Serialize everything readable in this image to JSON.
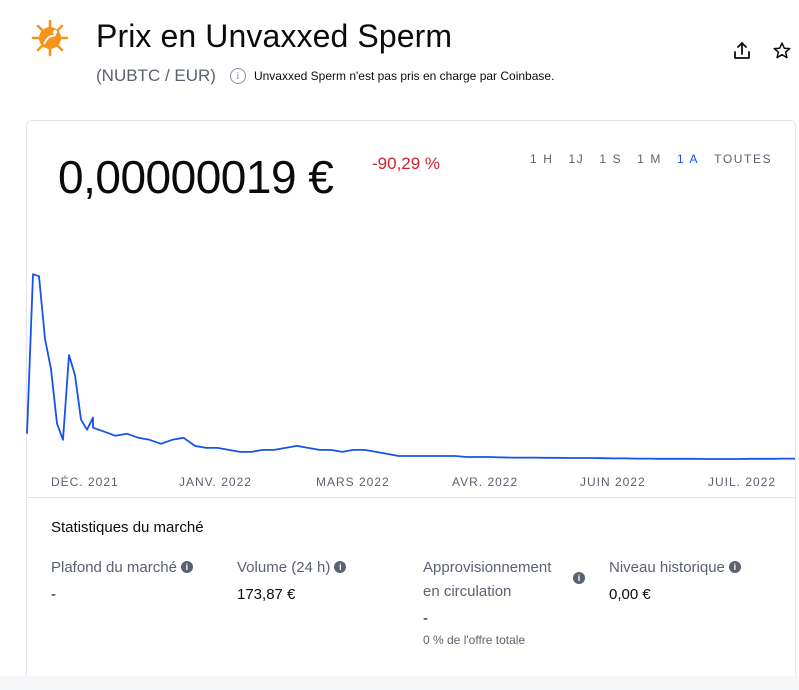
{
  "header": {
    "title": "Prix en Unvaxxed Sperm",
    "ticker": "(NUBTC / EUR)",
    "notice": "Unvaxxed Sperm n'est pas pris en charge par Coinbase.",
    "info_glyph": "i"
  },
  "icons": {
    "logo": "virus-logo-icon",
    "share": "share-icon",
    "star": "star-icon"
  },
  "colors": {
    "accent": "#1652f0",
    "negative": "#cf202f",
    "logo": "#f7931a"
  },
  "price": {
    "value": "0,00000019 €",
    "change": "-90,29 %"
  },
  "ranges": [
    {
      "label": "1 H",
      "active": false
    },
    {
      "label": "1J",
      "active": false
    },
    {
      "label": "1 S",
      "active": false
    },
    {
      "label": "1 M",
      "active": false
    },
    {
      "label": "1 A",
      "active": true
    },
    {
      "label": "TOUTES",
      "active": false
    }
  ],
  "chart_data": {
    "type": "line",
    "x_ticks": [
      "DÉC. 2021",
      "JANV. 2022",
      "MARS 2022",
      "AVR. 2022",
      "JUIN 2022",
      "JUIL. 2022"
    ],
    "series": [
      {
        "values": [
          0.13,
          0.92,
          0.91,
          0.6,
          0.45,
          0.18,
          0.1,
          0.52,
          0.42,
          0.2,
          0.15,
          0.21,
          0.16,
          0.14,
          0.12,
          0.13,
          0.11,
          0.1,
          0.08,
          0.1,
          0.11,
          0.07,
          0.06,
          0.06,
          0.05,
          0.04,
          0.04,
          0.05,
          0.05,
          0.06,
          0.07,
          0.06,
          0.05,
          0.05,
          0.04,
          0.05,
          0.05,
          0.04,
          0.03,
          0.02,
          0.02,
          0.02,
          0.02,
          0.02,
          0.02,
          0.015,
          0.015,
          0.015,
          0.013,
          0.012,
          0.012,
          0.012,
          0.011,
          0.011,
          0.01,
          0.01,
          0.01,
          0.009,
          0.008,
          0.008,
          0.007,
          0.007,
          0.006,
          0.006,
          0.006,
          0.006,
          0.005,
          0.005,
          0.005,
          0.005,
          0.006,
          0.006,
          0.006,
          0.007,
          0.007
        ]
      }
    ],
    "ylim": [
      0,
      1
    ],
    "grid": false,
    "line_color": "#1652f0"
  },
  "stats": {
    "title": "Statistiques du marché",
    "items": [
      {
        "label": "Plafond du marché",
        "value": "-",
        "sub": ""
      },
      {
        "label": "Volume (24 h)",
        "value": "173,87 €",
        "sub": ""
      },
      {
        "label_line1": "Approvisionnement",
        "label_line2": "en circulation",
        "value": "-",
        "sub": "0 % de l'offre totale"
      },
      {
        "label": "Niveau historique",
        "value": "0,00 €",
        "sub": ""
      }
    ]
  }
}
